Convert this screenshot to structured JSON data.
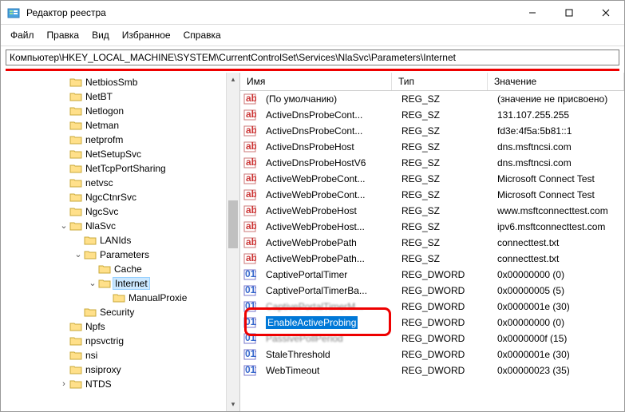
{
  "titlebar": {
    "title": "Редактор реестра"
  },
  "menu": {
    "file": "Файл",
    "edit": "Правка",
    "view": "Вид",
    "favorites": "Избранное",
    "help": "Справка"
  },
  "address": "Компьютер\\HKEY_LOCAL_MACHINE\\SYSTEM\\CurrentControlSet\\Services\\NlaSvc\\Parameters\\Internet",
  "tree": [
    {
      "d": 4,
      "t": "",
      "l": "NetbiosSmb"
    },
    {
      "d": 4,
      "t": "",
      "l": "NetBT"
    },
    {
      "d": 4,
      "t": "",
      "l": "Netlogon"
    },
    {
      "d": 4,
      "t": "",
      "l": "Netman"
    },
    {
      "d": 4,
      "t": "",
      "l": "netprofm"
    },
    {
      "d": 4,
      "t": "",
      "l": "NetSetupSvc"
    },
    {
      "d": 4,
      "t": "",
      "l": "NetTcpPortSharing"
    },
    {
      "d": 4,
      "t": "",
      "l": "netvsc"
    },
    {
      "d": 4,
      "t": "",
      "l": "NgcCtnrSvc"
    },
    {
      "d": 4,
      "t": "",
      "l": "NgcSvc"
    },
    {
      "d": 4,
      "t": "v",
      "l": "NlaSvc"
    },
    {
      "d": 5,
      "t": "",
      "l": "LANIds"
    },
    {
      "d": 5,
      "t": "v",
      "l": "Parameters"
    },
    {
      "d": 6,
      "t": "",
      "l": "Cache"
    },
    {
      "d": 6,
      "t": "v",
      "l": "Internet",
      "sel": true
    },
    {
      "d": 7,
      "t": "",
      "l": "ManualProxie"
    },
    {
      "d": 5,
      "t": "",
      "l": "Security"
    },
    {
      "d": 4,
      "t": "",
      "l": "Npfs"
    },
    {
      "d": 4,
      "t": "",
      "l": "npsvctrig"
    },
    {
      "d": 4,
      "t": "",
      "l": "nsi"
    },
    {
      "d": 4,
      "t": "",
      "l": "nsiproxy"
    },
    {
      "d": 4,
      "t": ">",
      "l": "NTDS"
    }
  ],
  "cols": {
    "name": "Имя",
    "type": "Тип",
    "value": "Значение"
  },
  "rows": [
    {
      "i": "sz",
      "n": "(По умолчанию)",
      "t": "REG_SZ",
      "v": "(значение не присвоено)"
    },
    {
      "i": "sz",
      "n": "ActiveDnsProbeCont...",
      "t": "REG_SZ",
      "v": "131.107.255.255"
    },
    {
      "i": "sz",
      "n": "ActiveDnsProbeCont...",
      "t": "REG_SZ",
      "v": "fd3e:4f5a:5b81::1"
    },
    {
      "i": "sz",
      "n": "ActiveDnsProbeHost",
      "t": "REG_SZ",
      "v": "dns.msftncsi.com"
    },
    {
      "i": "sz",
      "n": "ActiveDnsProbeHostV6",
      "t": "REG_SZ",
      "v": "dns.msftncsi.com"
    },
    {
      "i": "sz",
      "n": "ActiveWebProbeCont...",
      "t": "REG_SZ",
      "v": "Microsoft Connect Test"
    },
    {
      "i": "sz",
      "n": "ActiveWebProbeCont...",
      "t": "REG_SZ",
      "v": "Microsoft Connect Test"
    },
    {
      "i": "sz",
      "n": "ActiveWebProbeHost",
      "t": "REG_SZ",
      "v": "www.msftconnecttest.com"
    },
    {
      "i": "sz",
      "n": "ActiveWebProbeHost...",
      "t": "REG_SZ",
      "v": "ipv6.msftconnecttest.com"
    },
    {
      "i": "sz",
      "n": "ActiveWebProbePath",
      "t": "REG_SZ",
      "v": "connecttest.txt"
    },
    {
      "i": "sz",
      "n": "ActiveWebProbePath...",
      "t": "REG_SZ",
      "v": "connecttest.txt"
    },
    {
      "i": "dw",
      "n": "CaptivePortalTimer",
      "t": "REG_DWORD",
      "v": "0x00000000 (0)"
    },
    {
      "i": "dw",
      "n": "CaptivePortalTimerBa...",
      "t": "REG_DWORD",
      "v": "0x00000005 (5)"
    },
    {
      "i": "dw",
      "n": "CaptivePortalTimerM...",
      "t": "REG_DWORD",
      "v": "0x0000001e (30)",
      "blur": true
    },
    {
      "i": "dw",
      "n": "EnableActiveProbing",
      "t": "REG_DWORD",
      "v": "0x00000000 (0)",
      "sel": true
    },
    {
      "i": "dw",
      "n": "PassivePollPeriod",
      "t": "REG_DWORD",
      "v": "0x0000000f (15)",
      "blur": true
    },
    {
      "i": "dw",
      "n": "StaleThreshold",
      "t": "REG_DWORD",
      "v": "0x0000001e (30)"
    },
    {
      "i": "dw",
      "n": "WebTimeout",
      "t": "REG_DWORD",
      "v": "0x00000023 (35)"
    }
  ]
}
